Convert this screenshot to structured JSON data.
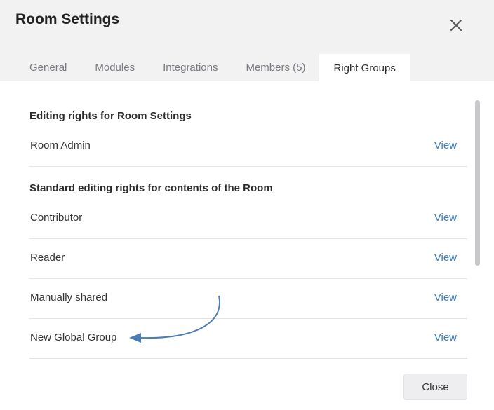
{
  "dialog": {
    "title": "Room Settings",
    "close_icon": "close-icon"
  },
  "tabs": [
    {
      "label": "General",
      "active": false
    },
    {
      "label": "Modules",
      "active": false
    },
    {
      "label": "Integrations",
      "active": false
    },
    {
      "label": "Members (5)",
      "active": false
    },
    {
      "label": "Right Groups",
      "active": true
    }
  ],
  "sections": [
    {
      "heading": "Editing rights for Room Settings",
      "rows": [
        {
          "label": "Room Admin",
          "link": "View"
        }
      ]
    },
    {
      "heading": "Standard editing rights for contents of the Room",
      "rows": [
        {
          "label": "Contributor",
          "link": "View"
        },
        {
          "label": "Reader",
          "link": "View"
        },
        {
          "label": "Manually shared",
          "link": "View"
        },
        {
          "label": "New Global Group",
          "link": "View"
        }
      ]
    }
  ],
  "footer": {
    "close_label": "Close"
  },
  "colors": {
    "link": "#3b7bbf",
    "arrow": "#4a7db5",
    "header_bg": "#f2f2f3"
  }
}
